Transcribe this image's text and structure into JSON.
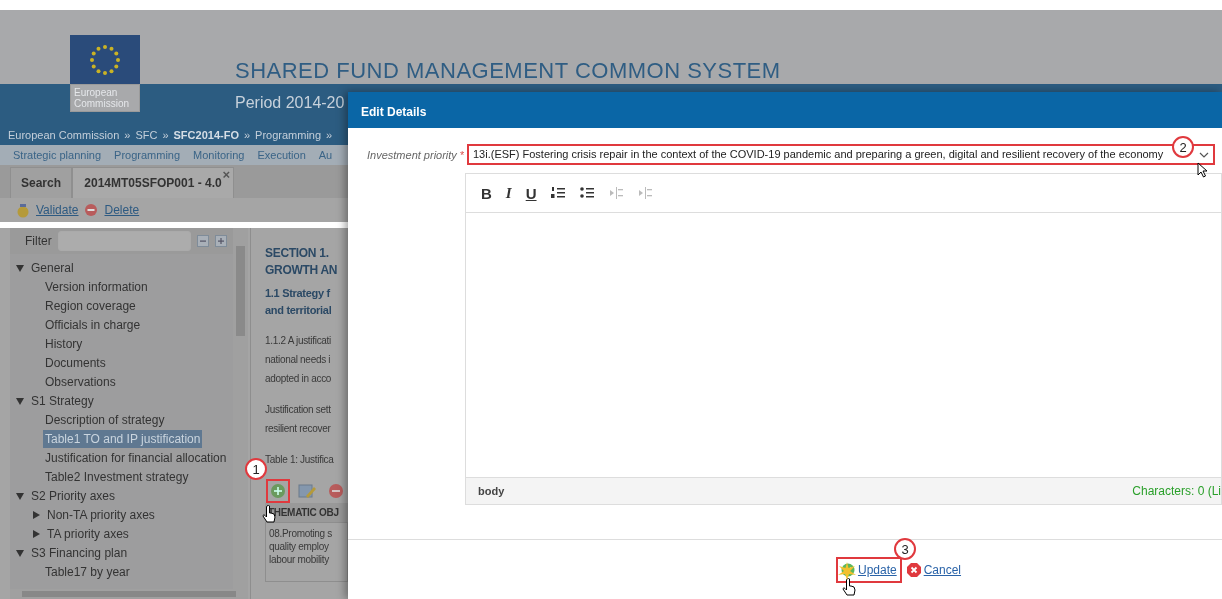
{
  "header": {
    "logo_text": "European Commission",
    "title": "SHARED FUND MANAGEMENT COMMON SYSTEM",
    "period": "Period 2014-20"
  },
  "breadcrumb": [
    {
      "label": "European Commission",
      "current": false
    },
    {
      "label": "SFC",
      "current": false
    },
    {
      "label": "SFC2014-FO",
      "current": true
    },
    {
      "label": "Programming",
      "current": false
    }
  ],
  "breadcrumb_separator": "»",
  "menu": [
    "Strategic planning",
    "Programming",
    "Monitoring",
    "Execution",
    "Au"
  ],
  "tabs": [
    {
      "label": "Search",
      "selected": false
    },
    {
      "label": "2014MT05SFOP001 - 4.0",
      "selected": true,
      "close": "×"
    }
  ],
  "actions": [
    {
      "label": "Validate",
      "kind": "validate"
    },
    {
      "label": "Delete",
      "kind": "delete"
    }
  ],
  "filter": {
    "label": "Filter"
  },
  "tree": [
    {
      "label": "General",
      "expanded": true,
      "selected": false,
      "children": [
        {
          "label": "Version information",
          "selected": false
        },
        {
          "label": "Region coverage",
          "selected": false
        },
        {
          "label": "Officials in charge",
          "selected": false
        },
        {
          "label": "History",
          "selected": false
        },
        {
          "label": "Documents",
          "selected": false
        },
        {
          "label": "Observations",
          "selected": false
        }
      ]
    },
    {
      "label": "S1 Strategy",
      "expanded": true,
      "selected": false,
      "children": [
        {
          "label": "Description of strategy",
          "selected": false
        },
        {
          "label": "Table1 TO and IP justification",
          "selected": true
        },
        {
          "label": "Justification for financial allocation",
          "selected": false
        },
        {
          "label": "Table2 Investment strategy",
          "selected": false
        }
      ]
    },
    {
      "label": "S2 Priority axes",
      "expanded": true,
      "selected": false,
      "children": [
        {
          "label": "Non-TA priority axes",
          "expanded": false,
          "selected": false
        },
        {
          "label": "TA priority axes",
          "expanded": false,
          "selected": false
        }
      ]
    },
    {
      "label": "S3 Financing plan",
      "expanded": true,
      "selected": false,
      "children": [
        {
          "label": "Table17 by year",
          "selected": false
        }
      ]
    }
  ],
  "content": {
    "heading": [
      "SECTION 1.",
      "GROWTH AN"
    ],
    "subheading": [
      "1.1 Strategy f",
      "and territorial"
    ],
    "paragraphs": [
      [
        "1.1.2 A justificati",
        "national needs i",
        "adopted in acco"
      ],
      [
        "Justification sett",
        "resilient recover"
      ],
      [
        "Table 1: Justifica"
      ]
    ],
    "table_toolbar": [
      {
        "kind": "add",
        "highlighted": true
      },
      {
        "kind": "edit",
        "highlighted": false
      },
      {
        "kind": "remove",
        "highlighted": false
      }
    ],
    "table": {
      "column_1": "THEMATIC OBJ",
      "cell": [
        "08.Promoting s",
        "quality employ",
        "labour mobility"
      ]
    }
  },
  "dialog": {
    "title": "Edit Details",
    "field": {
      "label": "Investment priority",
      "required": "*",
      "highlighted": true,
      "value": "13i.(ESF) Fostering crisis repair in the context of the COVID-19 pandemic and preparing a green, digital and resilient recovery of the economy"
    },
    "editor": {
      "toolbar": [
        {
          "kind": "bold",
          "label": "B",
          "disabled": false
        },
        {
          "kind": "italic",
          "label": "I",
          "disabled": false
        },
        {
          "kind": "underline",
          "label": "U",
          "disabled": false
        },
        {
          "kind": "ordered-list",
          "disabled": false
        },
        {
          "kind": "bullet-list",
          "disabled": false
        },
        {
          "kind": "outdent",
          "disabled": true
        },
        {
          "kind": "indent",
          "disabled": true
        }
      ],
      "path": "body",
      "counter": "Characters: 0 (Li"
    },
    "buttons": [
      {
        "label": "Update",
        "kind": "update",
        "highlighted": true
      },
      {
        "label": "Cancel",
        "kind": "cancel",
        "highlighted": false
      }
    ]
  },
  "annotations": [
    {
      "number": "1"
    },
    {
      "number": "2"
    },
    {
      "number": "3"
    }
  ]
}
